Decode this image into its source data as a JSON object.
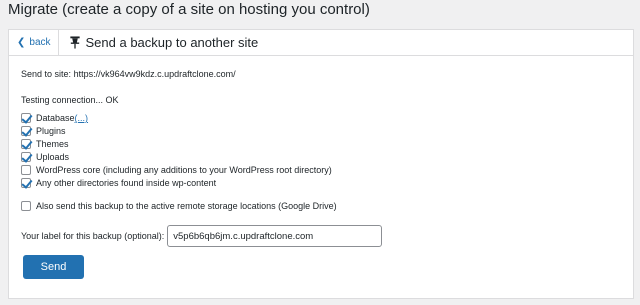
{
  "page_title": "Migrate (create a copy of a site on hosting you control)",
  "header": {
    "back_label": "back",
    "title": "Send a backup to another site"
  },
  "send_to": {
    "label": "Send to site:",
    "url": "https://vk964vw9kdz.c.updraftclone.com/"
  },
  "testing": "Testing connection... OK",
  "checkboxes": [
    {
      "label": "Database",
      "extra": "(...)",
      "checked": true
    },
    {
      "label": "Plugins",
      "checked": true
    },
    {
      "label": "Themes",
      "checked": true
    },
    {
      "label": "Uploads",
      "checked": true
    },
    {
      "label": "WordPress core (including any additions to your WordPress root directory)",
      "checked": false
    },
    {
      "label": "Any other directories found inside wp-content",
      "checked": true
    }
  ],
  "remote_storage": {
    "label": "Also send this backup to the active remote storage locations (Google Drive)",
    "checked": false
  },
  "backup_label": {
    "label": "Your label for this backup (optional):",
    "value": "v5p6b6qb6jm.c.updraftclone.com"
  },
  "send_button": "Send",
  "colors": {
    "accent": "#2271b1",
    "background": "#f0f0f1",
    "panel": "#ffffff"
  }
}
